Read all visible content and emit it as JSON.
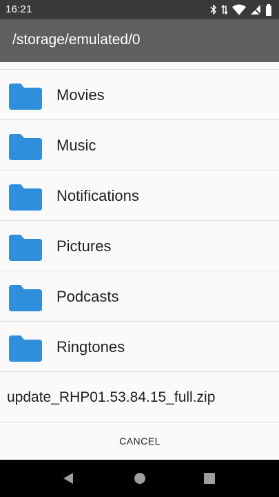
{
  "status_bar": {
    "time": "16:21",
    "icons": [
      "bluetooth-icon",
      "data-arrows-icon",
      "wifi-icon",
      "no-signal-icon",
      "battery-icon"
    ]
  },
  "title_bar": {
    "path": "/storage/emulated/0"
  },
  "folders": [
    {
      "name": "Movies",
      "icon": "folder-icon"
    },
    {
      "name": "Music",
      "icon": "folder-icon"
    },
    {
      "name": "Notifications",
      "icon": "folder-icon"
    },
    {
      "name": "Pictures",
      "icon": "folder-icon"
    },
    {
      "name": "Podcasts",
      "icon": "folder-icon"
    },
    {
      "name": "Ringtones",
      "icon": "folder-icon"
    }
  ],
  "files": [
    {
      "name": "update_RHP01.53.84.15_full.zip"
    }
  ],
  "actions": {
    "cancel_label": "CANCEL"
  },
  "nav_bar": {
    "buttons": [
      "back-icon",
      "home-icon",
      "recents-icon"
    ]
  },
  "colors": {
    "status_bar": "#3a3a3a",
    "title_bar": "#5f5f5f",
    "folder": "#2f8fdd",
    "nav_bar": "#000000"
  }
}
